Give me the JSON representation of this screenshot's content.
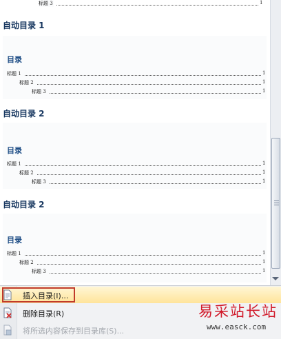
{
  "top_partial": {
    "label": "标题 3",
    "page": "1"
  },
  "gallery": {
    "items": [
      {
        "heading": "自动目录 1",
        "toc_title": "目录",
        "lines": [
          {
            "label": "标题 1",
            "page": "1"
          },
          {
            "label": "标题 2",
            "page": "1"
          },
          {
            "label": "标题 3",
            "page": "1"
          }
        ]
      },
      {
        "heading": "自动目录 2",
        "toc_title": "目录",
        "lines": [
          {
            "label": "标题 1",
            "page": "1"
          },
          {
            "label": "标题 2",
            "page": "1"
          },
          {
            "label": "标题 3",
            "page": "1"
          }
        ]
      },
      {
        "heading": "自动目录 2",
        "toc_title": "目录",
        "lines": [
          {
            "label": "标题 1",
            "page": "1"
          },
          {
            "label": "标题 2",
            "page": "1"
          },
          {
            "label": "标题 3",
            "page": "1"
          }
        ]
      }
    ]
  },
  "menu": {
    "items": [
      {
        "label": "插入目录(I)...",
        "icon": "document-icon",
        "state": "hover"
      },
      {
        "label": "删除目录(R)",
        "icon": "delete-document-icon",
        "state": "normal"
      },
      {
        "label": "将所选内容保存到目录库(S)...",
        "icon": "save-to-library-icon",
        "state": "disabled"
      }
    ]
  },
  "watermark": {
    "text": "易采站长站",
    "url": "www.easck.com"
  },
  "colors": {
    "heading": "#15355e",
    "toc_title": "#1f4e86",
    "hover_fill": "#ffe49a",
    "callout_border": "#c0392b",
    "watermark": "#d11a2a"
  }
}
